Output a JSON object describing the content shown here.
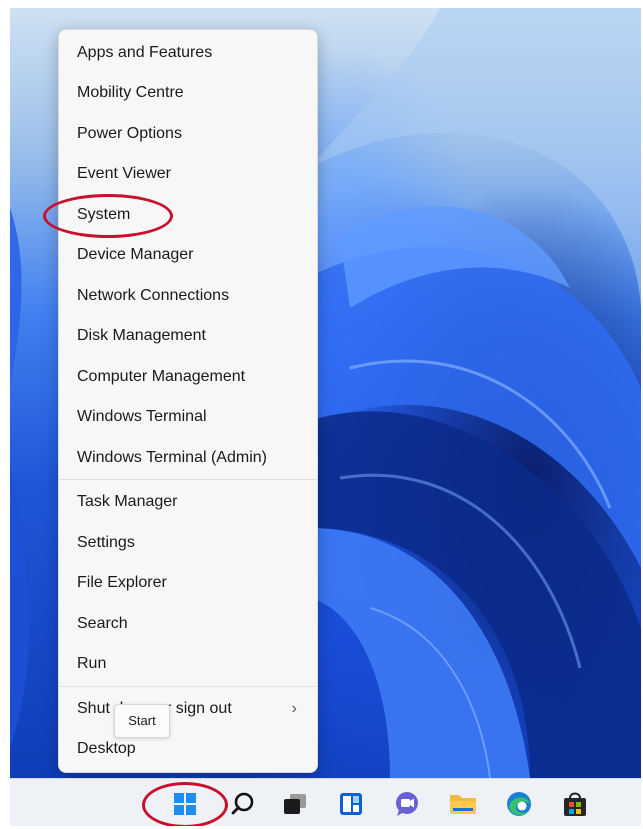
{
  "menu": {
    "group1": [
      "Apps and Features",
      "Mobility Centre",
      "Power Options",
      "Event Viewer",
      "System",
      "Device Manager",
      "Network Connections",
      "Disk Management",
      "Computer Management",
      "Windows Terminal",
      "Windows Terminal (Admin)"
    ],
    "group2": [
      "Task Manager",
      "Settings",
      "File Explorer",
      "Search",
      "Run"
    ],
    "group3": [
      "Shut down or sign out",
      "Desktop"
    ]
  },
  "tooltip": "Start",
  "taskbar": {
    "icons": [
      "start-icon",
      "search-icon",
      "task-view-icon",
      "widgets-icon",
      "chat-icon",
      "file-explorer-icon",
      "edge-icon",
      "store-icon"
    ]
  },
  "colors": {
    "annotation": "#c8102e",
    "menu_bg": "#f7f7f7",
    "taskbar_bg": "#eef1f6",
    "accent": "#0078d4"
  }
}
